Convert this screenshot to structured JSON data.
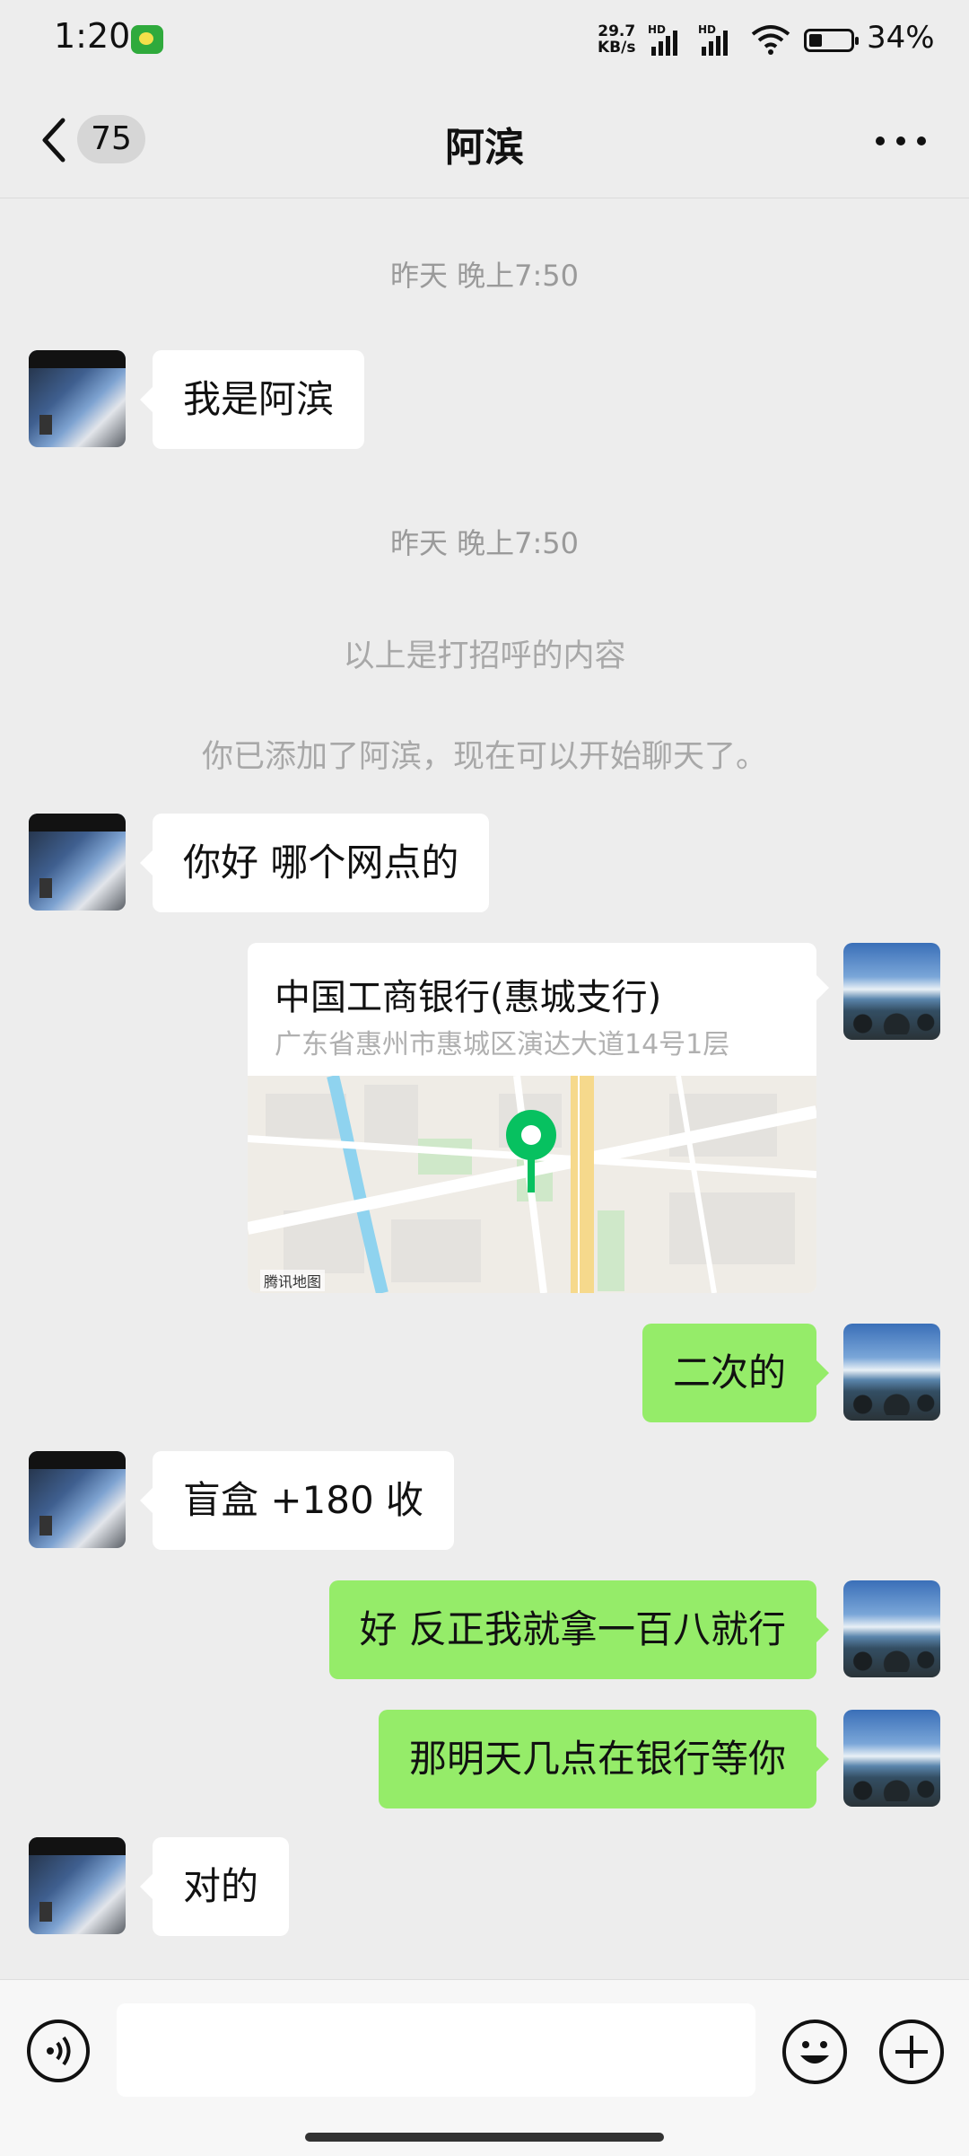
{
  "status_bar": {
    "time": "1:20",
    "net_speed_value": "29.7",
    "net_speed_unit": "KB/s",
    "sim1_label": "HD",
    "sim2_label": "HD",
    "battery": "34%"
  },
  "header": {
    "unread_count": "75",
    "title": "阿滨"
  },
  "messages": {
    "time1": "昨天 晚上7:50",
    "msg1": "我是阿滨",
    "time2": "昨天 晚上7:50",
    "system1": "以上是打招呼的内容",
    "system2": "你已添加了阿滨，现在可以开始聊天了。",
    "msg2": "你好 哪个网点的",
    "location": {
      "name": "中国工商银行(惠城支行)",
      "address": "广东省惠州市惠城区演达大道14号1层",
      "map_caption": "腾讯地图"
    },
    "msg3": "二次的",
    "msg4": "盲盒 +180 收",
    "msg5": "好 反正我就拿一百八就行",
    "msg6": "那明天几点在银行等你",
    "msg7": "对的"
  },
  "input_bar": {
    "value": ""
  },
  "colors": {
    "background": "#ededed",
    "sent_bubble": "#95ec69",
    "received_bubble": "#ffffff",
    "map_pin": "#07c160"
  }
}
